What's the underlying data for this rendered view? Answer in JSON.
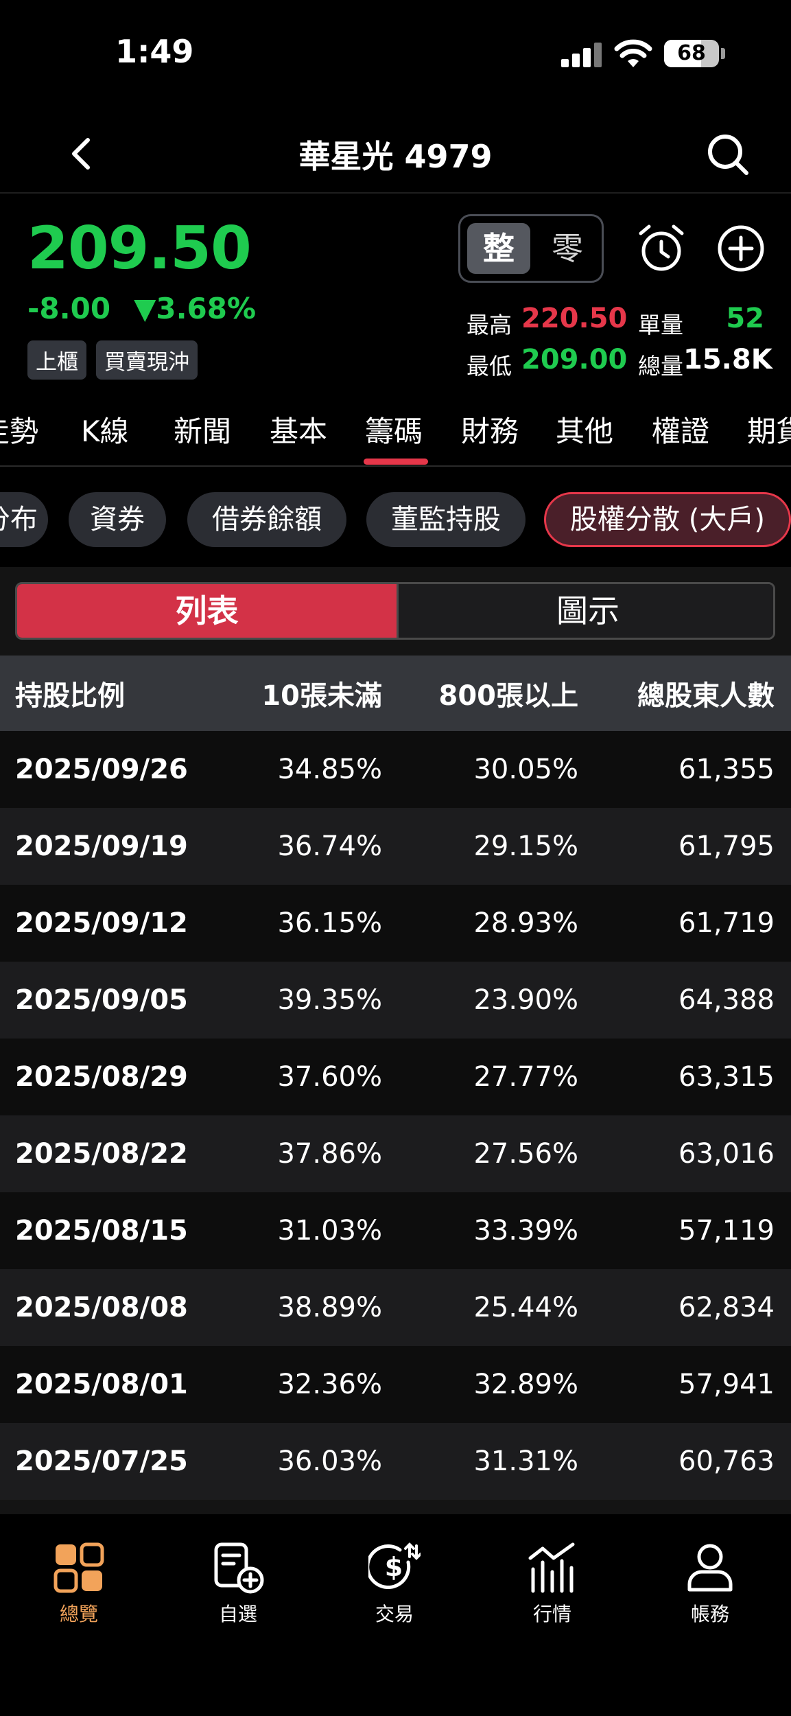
{
  "status_bar": {
    "time": "1:49",
    "battery": "68"
  },
  "header": {
    "title": "華星光 4979"
  },
  "quote": {
    "price": "209.50",
    "change": "-8.00",
    "change_pct": "▼3.68%",
    "tags": [
      "上櫃",
      "買賣現沖"
    ],
    "lot_whole": "整",
    "lot_odd": "零",
    "high_label": "最高",
    "high_value": "220.50",
    "low_label": "最低",
    "low_value": "209.00",
    "volume_label": "單量",
    "volume_value": "52",
    "total_label": "總量",
    "total_value": "15.8K"
  },
  "main_tabs": [
    "走勢",
    "K線",
    "新聞",
    "基本",
    "籌碼",
    "財務",
    "其他",
    "權證",
    "期貨"
  ],
  "sub_chips": [
    "分布",
    "資券",
    "借券餘額",
    "董監持股",
    "股權分散 (大戶)"
  ],
  "view_toggle": {
    "list": "列表",
    "chart": "圖示"
  },
  "table": {
    "headers": [
      "持股比例",
      "10張未滿",
      "800張以上",
      "總股東人數"
    ],
    "rows": [
      [
        "2025/09/26",
        "34.85%",
        "30.05%",
        "61,355"
      ],
      [
        "2025/09/19",
        "36.74%",
        "29.15%",
        "61,795"
      ],
      [
        "2025/09/12",
        "36.15%",
        "28.93%",
        "61,719"
      ],
      [
        "2025/09/05",
        "39.35%",
        "23.90%",
        "64,388"
      ],
      [
        "2025/08/29",
        "37.60%",
        "27.77%",
        "63,315"
      ],
      [
        "2025/08/22",
        "37.86%",
        "27.56%",
        "63,016"
      ],
      [
        "2025/08/15",
        "31.03%",
        "33.39%",
        "57,119"
      ],
      [
        "2025/08/08",
        "38.89%",
        "25.44%",
        "62,834"
      ],
      [
        "2025/08/01",
        "32.36%",
        "32.89%",
        "57,941"
      ],
      [
        "2025/07/25",
        "36.03%",
        "31.31%",
        "60,763"
      ]
    ]
  },
  "bottom_nav": [
    "總覽",
    "自選",
    "交易",
    "行情",
    "帳務"
  ],
  "colors": {
    "up": "#e6374a",
    "down": "#1fcb4f",
    "accent": "#e6374a",
    "nav_active": "#f2a35a"
  }
}
